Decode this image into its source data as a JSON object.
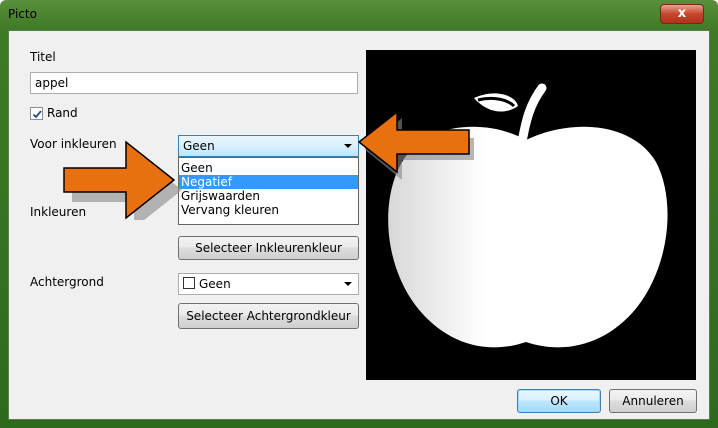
{
  "window": {
    "title": "Picto",
    "close_label": "x"
  },
  "fields": {
    "titel_label": "Titel",
    "titel_value": "appel",
    "rand_label": "Rand",
    "rand_checked": true,
    "voor_inkleuren_label": "Voor inkleuren",
    "voor_inkleuren_value": "Geen",
    "voor_inkleuren_options": [
      "Geen",
      "Negatief",
      "Grijswaarden",
      "Vervang kleuren"
    ],
    "voor_inkleuren_highlighted": "Negatief",
    "inkleuren_label": "Inkleuren",
    "inkleuren_button": "Selecteer Inkleurenkleur",
    "achtergrond_label": "Achtergrond",
    "achtergrond_value": "Geen",
    "achtergrond_button": "Selecteer Achtergrondkleur"
  },
  "buttons": {
    "ok": "OK",
    "cancel": "Annuleren"
  },
  "preview": {
    "image": "apple-icon",
    "background": "#000000",
    "foreground": "#ffffff"
  },
  "annotations": {
    "arrow_color": "#e8700f",
    "arrows": [
      "arrow-pointing-right-to-negatief",
      "arrow-pointing-left-to-combo"
    ]
  }
}
